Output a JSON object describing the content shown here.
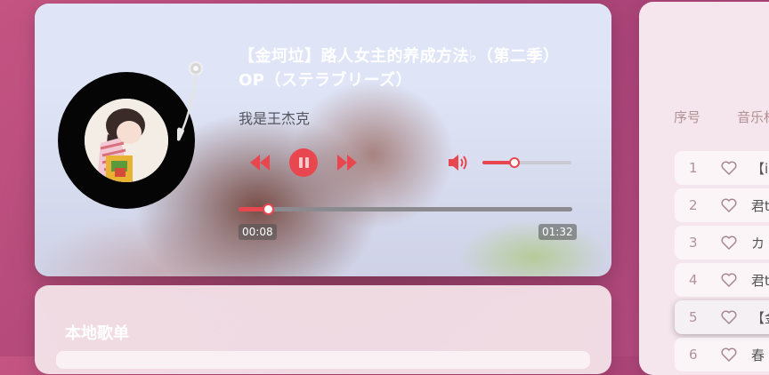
{
  "player": {
    "title": "【金坷垃】路人女主的养成方法♭（第二季）OP（ステラブリーズ）",
    "artist": "我是王杰克",
    "current_time": "00:08",
    "total_time": "01:32",
    "progress": 0.087,
    "volume": 0.36,
    "state": "playing"
  },
  "local_playlist": {
    "title": "本地歌单"
  },
  "song_list": {
    "headers": {
      "number": "序号",
      "name": "音乐标"
    },
    "rows": [
      {
        "num": "1",
        "name": "【i",
        "active": false
      },
      {
        "num": "2",
        "name": "君t",
        "active": false
      },
      {
        "num": "3",
        "name": "カ",
        "active": false
      },
      {
        "num": "4",
        "name": "君t",
        "active": false
      },
      {
        "num": "5",
        "name": "【金",
        "active": true
      },
      {
        "num": "6",
        "name": "春",
        "active": false
      }
    ]
  },
  "colors": {
    "accent": "#e8474f",
    "page_bg": "#b44a7a",
    "card_bg": "#f4e6ec"
  },
  "icons": {
    "prev": "rewind-icon",
    "pause": "pause-icon",
    "next": "fast-forward-icon",
    "volume": "volume-icon",
    "like": "heart-icon"
  }
}
